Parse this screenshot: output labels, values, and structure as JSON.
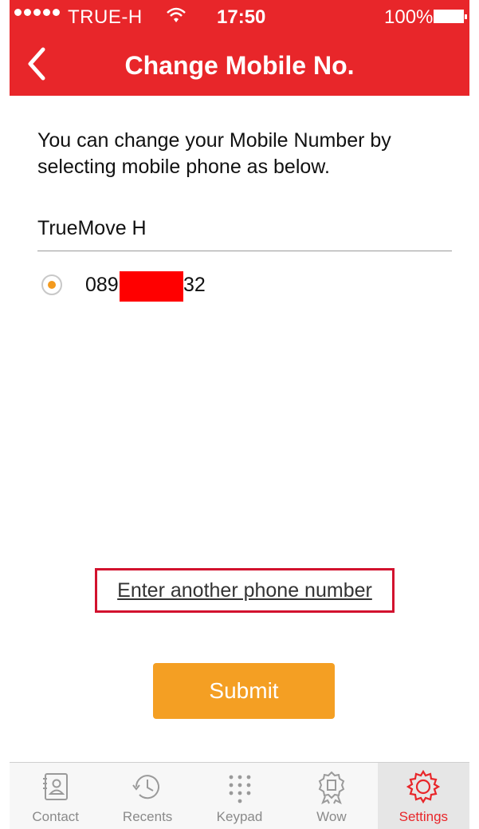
{
  "status_bar": {
    "carrier": "TRUE-H",
    "time": "17:50",
    "battery": "100%"
  },
  "nav": {
    "title": "Change Mobile No."
  },
  "content": {
    "description": "You can change your Mobile Number by selecting mobile phone as below.",
    "operator_label": "TrueMove H",
    "phone": {
      "prefix": "089",
      "suffix": "32",
      "selected": true
    },
    "another_number_link": "Enter another phone number",
    "submit_label": "Submit"
  },
  "tabs": [
    {
      "label": "Contact",
      "icon": "contact-card-icon",
      "active": false
    },
    {
      "label": "Recents",
      "icon": "clock-icon",
      "active": false
    },
    {
      "label": "Keypad",
      "icon": "keypad-icon",
      "active": false
    },
    {
      "label": "Wow",
      "icon": "award-badge-icon",
      "active": false
    },
    {
      "label": "Settings",
      "icon": "gear-icon",
      "active": true
    }
  ],
  "colors": {
    "brand_red": "#e8262a",
    "accent_orange": "#f49f23"
  }
}
